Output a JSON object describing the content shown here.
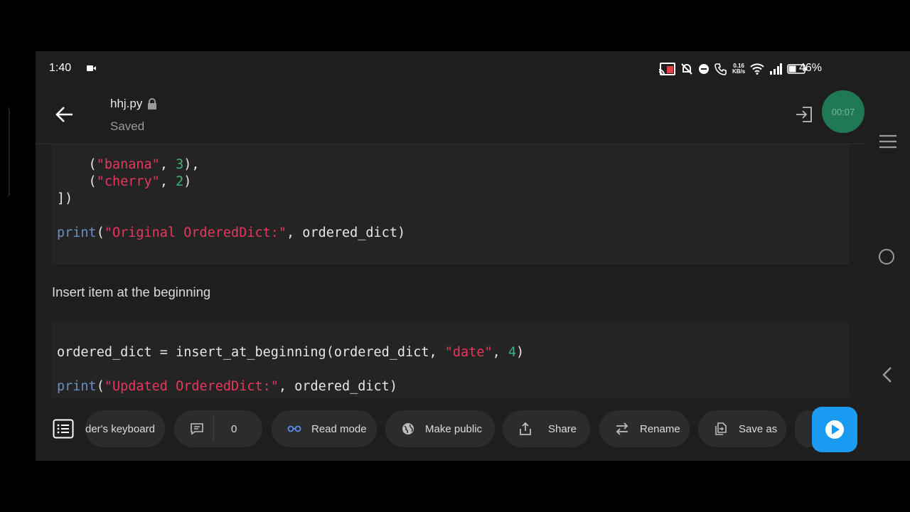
{
  "status_bar": {
    "time": "1:40",
    "net_speed_value": "0.16",
    "net_speed_unit": "KB/s",
    "battery": "46%",
    "icons": [
      "video-camera-icon",
      "cast-icon",
      "mute-icon",
      "dnd-icon",
      "wifi-call-icon",
      "wifi-icon",
      "signal-icon",
      "battery-icon"
    ]
  },
  "header": {
    "file_name": "hhj.py",
    "save_status": "Saved",
    "timer": "00:07"
  },
  "code_block_1": {
    "line1_indent": "    (",
    "line1_str": "\"banana\"",
    "line1_sep": ", ",
    "line1_num": "3",
    "line1_end": "),",
    "line2_indent": "    (",
    "line2_str": "\"cherry\"",
    "line2_sep": ", ",
    "line2_num": "2",
    "line2_end": ")",
    "line3": "])",
    "line5_fn": "print",
    "line5_open": "(",
    "line5_str": "\"Original OrderedDict:\"",
    "line5_rest": ", ordered_dict)"
  },
  "text_cell": "Insert item at the beginning",
  "code_block_2": {
    "line1_pre": "ordered_dict = insert_at_beginning(ordered_dict, ",
    "line1_str": "\"date\"",
    "line1_sep": ", ",
    "line1_num": "4",
    "line1_end": ")",
    "line3_fn": "print",
    "line3_open": "(",
    "line3_str": "\"Updated OrderedDict:\"",
    "line3_rest": ", ordered_dict)"
  },
  "toolbar": {
    "keyboard_label": "der's keyboard",
    "comments_count": "0",
    "read_mode": "Read mode",
    "make_public": "Make public",
    "share": "Share",
    "rename": "Rename",
    "save_as": "Save as"
  },
  "colors": {
    "string": "#e8365d",
    "number": "#3fb47a",
    "function": "#6d8cc4",
    "accent_blue": "#1a9af0",
    "timer_green": "#1e8a5e"
  }
}
